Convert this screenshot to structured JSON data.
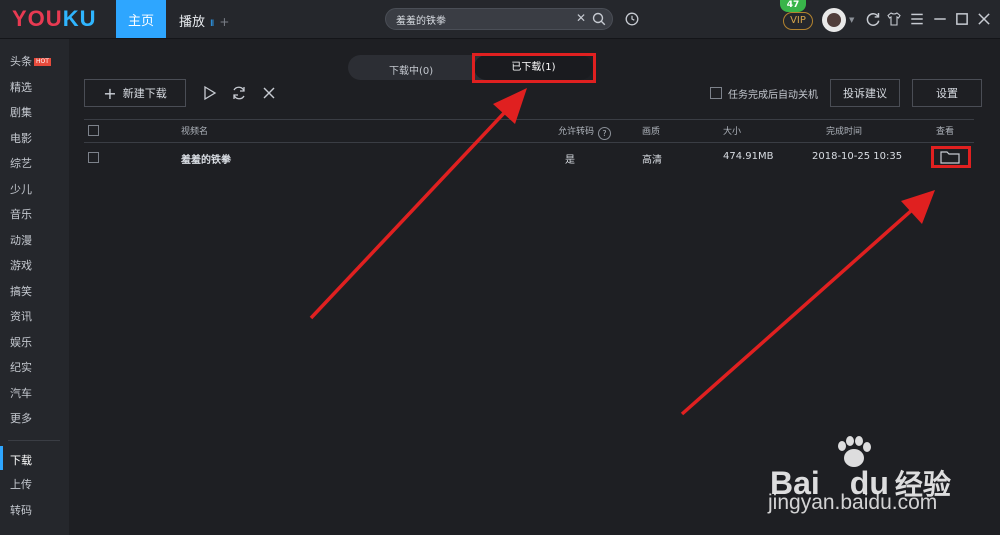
{
  "app": {
    "logo_left": "YOU",
    "logo_right": "KU",
    "tabs": [
      {
        "label": "主页"
      },
      {
        "label": "播放"
      }
    ],
    "play_indicator": "II",
    "add_tab": "+",
    "search_value": "羞羞的铁拳",
    "notification_count": "47",
    "vip_label": "VIP"
  },
  "sidebar": {
    "items": [
      "头条",
      "精选",
      "剧集",
      "电影",
      "综艺",
      "少儿",
      "音乐",
      "动漫",
      "游戏",
      "搞笑",
      "资讯",
      "娱乐",
      "纪实",
      "汽车",
      "更多"
    ],
    "hot_badge": "HOT",
    "bottom_items": [
      "下载",
      "上传",
      "转码"
    ]
  },
  "download_tabs": {
    "downloading": "下载中(0)",
    "downloaded": "已下载(1)"
  },
  "toolbar": {
    "new_download": "新建下载",
    "auto_shutdown": "任务完成后自动关机",
    "feedback": "投诉建议",
    "settings": "设置"
  },
  "table": {
    "headers": [
      "视频名",
      "允许转码",
      "画质",
      "大小",
      "完成时间",
      "查看"
    ],
    "help_mark": "?",
    "rows": [
      {
        "name": "羞羞的铁拳",
        "transcode": "是",
        "quality": "高清",
        "size": "474.91MB",
        "finished": "2018-10-25 10:35"
      }
    ]
  },
  "watermark": {
    "brand": "Bai",
    "brand2": "du",
    "cn": "经验",
    "url": "jingyan.baidu.com"
  },
  "colors": {
    "accent": "#2ea6ff",
    "annotation_red": "#e02020",
    "background": "#1e1f23"
  }
}
